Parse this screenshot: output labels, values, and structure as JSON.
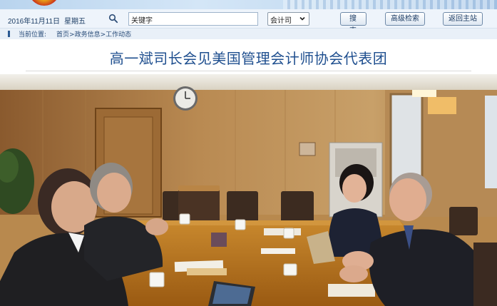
{
  "header": {
    "date": "2016年11月11日",
    "weekday": "星期五"
  },
  "search": {
    "value": "关键字",
    "scope_selected": "会计司",
    "search_button": "搜 索",
    "advanced_button": "高级检索",
    "home_button": "返回主站"
  },
  "breadcrumb": {
    "prefix": "当前位置:",
    "path": "首页>政务信息>工作动态"
  },
  "article": {
    "title": "高一斌司长会见美国管理会计师协会代表团"
  },
  "icons": [
    "search-icon",
    "chevron-down-icon"
  ],
  "colors": {
    "title": "#1f4f8f",
    "toolbar_bg": "#eef4fb",
    "breadcrumb_text": "#284b78"
  }
}
